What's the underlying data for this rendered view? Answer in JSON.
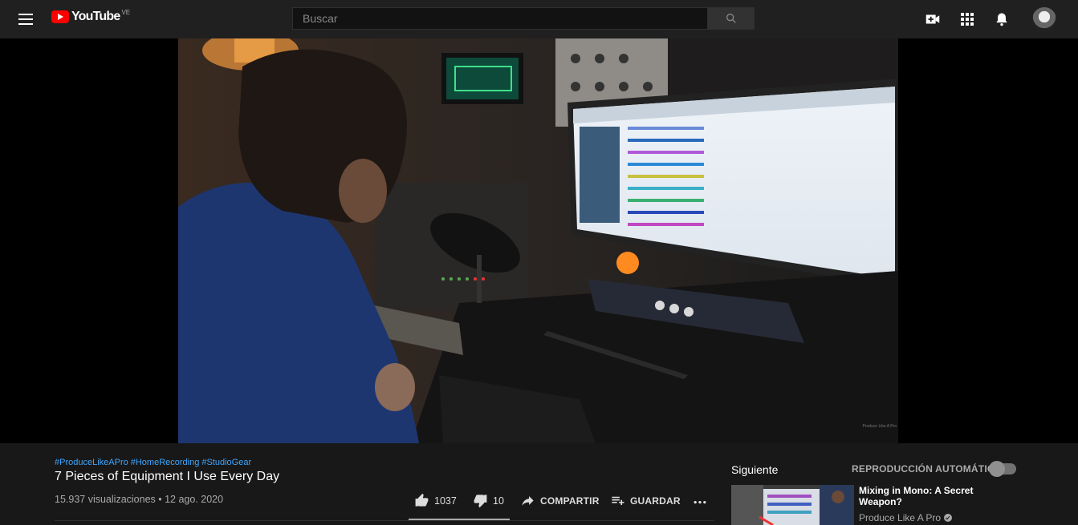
{
  "header": {
    "logo_text": "YouTube",
    "country_code": "VE",
    "search_placeholder": "Buscar"
  },
  "player": {
    "watermark": "Produce Like A Pro"
  },
  "video": {
    "hashtags": [
      "#ProduceLikeAPro",
      "#HomeRecording",
      "#StudioGear"
    ],
    "title": "7 Pieces of Equipment I Use Every Day",
    "views_date": "15.937 visualizaciones • 12 ago. 2020",
    "likes": "1037",
    "dislikes": "10",
    "share_label": "COMPARTIR",
    "save_label": "GUARDAR"
  },
  "sidebar": {
    "up_next_label": "Siguiente",
    "autoplay_label": "REPRODUCCIÓN AUTOMÁTICA",
    "autoplay_on": false,
    "next_video": {
      "title": "Mixing in Mono: A Secret Weapon?",
      "channel": "Produce Like A Pro"
    }
  },
  "colors": {
    "brand_red": "#ff0000",
    "hashtag_blue": "#3ea6ff",
    "background": "#181818",
    "topbar": "#202020"
  }
}
